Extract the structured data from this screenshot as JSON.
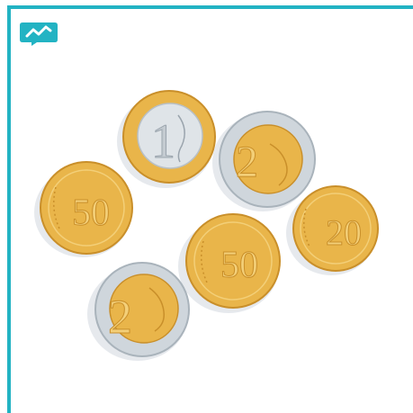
{
  "badge": {
    "icon": "trend-line-icon",
    "color": "#22b3c3"
  },
  "colors": {
    "frame": "#22b3c3",
    "gold": "#e9b54a",
    "gold_light": "#f3cf78",
    "gold_dark": "#c98f2a",
    "silver": "#cfd6dc",
    "silver_dark": "#a9b3bb",
    "shadow": "#e6e9ed"
  },
  "coins": [
    {
      "denomination": "1",
      "kind": "bimetal-gold-ring"
    },
    {
      "denomination": "2",
      "kind": "bimetal-silver-ring"
    },
    {
      "denomination": "50",
      "kind": "gold"
    },
    {
      "denomination": "50",
      "kind": "gold"
    },
    {
      "denomination": "20",
      "kind": "gold"
    },
    {
      "denomination": "2",
      "kind": "bimetal-silver-ring"
    }
  ]
}
